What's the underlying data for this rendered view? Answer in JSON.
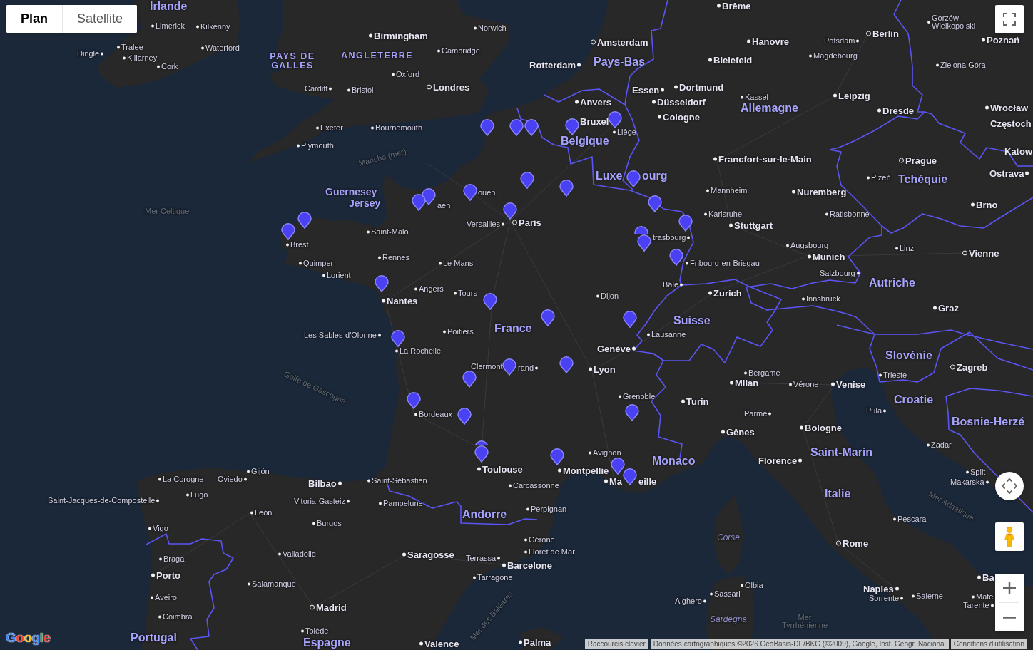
{
  "map_type_control": {
    "tabs": [
      {
        "label": "Plan",
        "selected": true
      },
      {
        "label": "Satellite",
        "selected": false
      }
    ]
  },
  "map": {
    "places": [
      {
        "name": "Irlande",
        "kind": "country"
      },
      {
        "name": "Limerick",
        "kind": "town"
      },
      {
        "name": "Kilkenny",
        "kind": "town"
      },
      {
        "name": "Dingle",
        "kind": "town"
      },
      {
        "name": "Tralee",
        "kind": "town"
      },
      {
        "name": "Waterford",
        "kind": "town"
      },
      {
        "name": "Killarney",
        "kind": "town"
      },
      {
        "name": "Cork",
        "kind": "town"
      },
      {
        "name": "Birmingham",
        "kind": "city"
      },
      {
        "name": "Norwich",
        "kind": "town"
      },
      {
        "name": "PAYS DE GALLES",
        "kind": "region"
      },
      {
        "name": "ANGLETERRE",
        "kind": "region"
      },
      {
        "name": "Cambridge",
        "kind": "town"
      },
      {
        "name": "Oxford",
        "kind": "town"
      },
      {
        "name": "Cardiff",
        "kind": "town"
      },
      {
        "name": "Bristol",
        "kind": "town"
      },
      {
        "name": "Londres",
        "kind": "capital"
      },
      {
        "name": "Exeter",
        "kind": "town"
      },
      {
        "name": "Bournemouth",
        "kind": "town"
      },
      {
        "name": "Plymouth",
        "kind": "town"
      },
      {
        "name": "Manche (mer)",
        "kind": "water"
      },
      {
        "name": "Mer Celtique",
        "kind": "water"
      },
      {
        "name": "Guernesey",
        "kind": "island"
      },
      {
        "name": "Jersey",
        "kind": "island"
      },
      {
        "name": "Brême",
        "kind": "city"
      },
      {
        "name": "Amsterdam",
        "kind": "capital"
      },
      {
        "name": "Hanovre",
        "kind": "city"
      },
      {
        "name": "Potsdam",
        "kind": "town"
      },
      {
        "name": "Berlin",
        "kind": "capital"
      },
      {
        "name": "Gorzów Wielkopolski",
        "kind": "town"
      },
      {
        "name": "Poznań",
        "kind": "city"
      },
      {
        "name": "Rotterdam",
        "kind": "city"
      },
      {
        "name": "Pays-Bas",
        "kind": "country"
      },
      {
        "name": "Bielefeld",
        "kind": "city"
      },
      {
        "name": "Magdebourg",
        "kind": "town"
      },
      {
        "name": "Zielona Góra",
        "kind": "town"
      },
      {
        "name": "Essen",
        "kind": "city"
      },
      {
        "name": "Dortmund",
        "kind": "city"
      },
      {
        "name": "Anvers",
        "kind": "city"
      },
      {
        "name": "Düsseldorf",
        "kind": "city"
      },
      {
        "name": "Kassel",
        "kind": "town"
      },
      {
        "name": "Leipzig",
        "kind": "city"
      },
      {
        "name": "Allemagne",
        "kind": "country"
      },
      {
        "name": "Dresde",
        "kind": "city"
      },
      {
        "name": "Wrocław",
        "kind": "city"
      },
      {
        "name": "Bruxel",
        "kind": "city"
      },
      {
        "name": "Cologne",
        "kind": "city"
      },
      {
        "name": "Częstoch",
        "kind": "city"
      },
      {
        "name": "Belgique",
        "kind": "country"
      },
      {
        "name": "Liège",
        "kind": "town"
      },
      {
        "name": "Francfort-sur-le-Main",
        "kind": "city"
      },
      {
        "name": "Prague",
        "kind": "capital"
      },
      {
        "name": "Katow",
        "kind": "city"
      },
      {
        "name": "Luxe",
        "kind": "country"
      },
      {
        "name": "ourg",
        "kind": "country"
      },
      {
        "name": "Plzeň",
        "kind": "town"
      },
      {
        "name": "Tchéquie",
        "kind": "country"
      },
      {
        "name": "Ostrava",
        "kind": "city"
      },
      {
        "name": "ouen",
        "kind": "town"
      },
      {
        "name": "Mannheim",
        "kind": "town"
      },
      {
        "name": "Nuremberg",
        "kind": "city"
      },
      {
        "name": "aen",
        "kind": "town"
      },
      {
        "name": "Brno",
        "kind": "city"
      },
      {
        "name": "Karlsruhe",
        "kind": "town"
      },
      {
        "name": "Ratisbonne",
        "kind": "town"
      },
      {
        "name": "Saint-Malo",
        "kind": "town"
      },
      {
        "name": "Versailles",
        "kind": "town"
      },
      {
        "name": "Paris",
        "kind": "capital"
      },
      {
        "name": "Stuttgart",
        "kind": "city"
      },
      {
        "name": "trasbourg",
        "kind": "town"
      },
      {
        "name": "Brest",
        "kind": "town"
      },
      {
        "name": "Augsbourg",
        "kind": "town"
      },
      {
        "name": "Linz",
        "kind": "town"
      },
      {
        "name": "Rennes",
        "kind": "town"
      },
      {
        "name": "Munich",
        "kind": "city"
      },
      {
        "name": "Vienne",
        "kind": "capital"
      },
      {
        "name": "Quimper",
        "kind": "town"
      },
      {
        "name": "Le Mans",
        "kind": "town"
      },
      {
        "name": "Fribourg-en-Brisgau",
        "kind": "town"
      },
      {
        "name": "Lorient",
        "kind": "town"
      },
      {
        "name": "Salzbourg",
        "kind": "town"
      },
      {
        "name": "Angers",
        "kind": "town"
      },
      {
        "name": "Nantes",
        "kind": "city"
      },
      {
        "name": "Tours",
        "kind": "town"
      },
      {
        "name": "Dijon",
        "kind": "town"
      },
      {
        "name": "Bâle",
        "kind": "town"
      },
      {
        "name": "Zurich",
        "kind": "city"
      },
      {
        "name": "Innsbruck",
        "kind": "town"
      },
      {
        "name": "Autriche",
        "kind": "country"
      },
      {
        "name": "Graz",
        "kind": "city"
      },
      {
        "name": "Les Sables-d'Olonne",
        "kind": "town"
      },
      {
        "name": "Poitiers",
        "kind": "town"
      },
      {
        "name": "France",
        "kind": "country"
      },
      {
        "name": "Suisse",
        "kind": "country"
      },
      {
        "name": "Lausanne",
        "kind": "town"
      },
      {
        "name": "La Rochelle",
        "kind": "town"
      },
      {
        "name": "Genève",
        "kind": "city"
      },
      {
        "name": "Slovénie",
        "kind": "country"
      },
      {
        "name": "Clermont",
        "kind": "town"
      },
      {
        "name": "rand",
        "kind": "town"
      },
      {
        "name": "Lyon",
        "kind": "city"
      },
      {
        "name": "Bergame",
        "kind": "town"
      },
      {
        "name": "Trieste",
        "kind": "town"
      },
      {
        "name": "Zagreb",
        "kind": "capital"
      },
      {
        "name": "Golfe de Gascogne",
        "kind": "water"
      },
      {
        "name": "Milan",
        "kind": "city"
      },
      {
        "name": "Vérone",
        "kind": "town"
      },
      {
        "name": "Venise",
        "kind": "city"
      },
      {
        "name": "Grenoble",
        "kind": "town"
      },
      {
        "name": "Turin",
        "kind": "city"
      },
      {
        "name": "Croatie",
        "kind": "country"
      },
      {
        "name": "Bordeaux",
        "kind": "town"
      },
      {
        "name": "Parme",
        "kind": "town"
      },
      {
        "name": "Pula",
        "kind": "town"
      },
      {
        "name": "Gênes",
        "kind": "city"
      },
      {
        "name": "Bologne",
        "kind": "city"
      },
      {
        "name": "Bosnie-Herzé",
        "kind": "country"
      },
      {
        "name": "Avignon",
        "kind": "town"
      },
      {
        "name": "Saint-Marin",
        "kind": "country"
      },
      {
        "name": "Zadar",
        "kind": "town"
      },
      {
        "name": "Gijón",
        "kind": "town"
      },
      {
        "name": "Toulouse",
        "kind": "city"
      },
      {
        "name": "Montpellie",
        "kind": "city"
      },
      {
        "name": "Monaco",
        "kind": "country"
      },
      {
        "name": "Florence",
        "kind": "city"
      },
      {
        "name": "Split",
        "kind": "town"
      },
      {
        "name": "La Corogne",
        "kind": "town"
      },
      {
        "name": "Oviedo",
        "kind": "town"
      },
      {
        "name": "Bilbao",
        "kind": "city"
      },
      {
        "name": "Saint-Sébastien",
        "kind": "town"
      },
      {
        "name": "Carcassonne",
        "kind": "town"
      },
      {
        "name": "Ma",
        "kind": "city"
      },
      {
        "name": "eille",
        "kind": "city"
      },
      {
        "name": "Makarska",
        "kind": "town"
      },
      {
        "name": "Saint-Jacques-de-Compostelle",
        "kind": "town"
      },
      {
        "name": "Lugo",
        "kind": "town"
      },
      {
        "name": "Vitoria-Gasteiz",
        "kind": "town"
      },
      {
        "name": "Pampelune",
        "kind": "town"
      },
      {
        "name": "Italie",
        "kind": "country"
      },
      {
        "name": "León",
        "kind": "town"
      },
      {
        "name": "Andorre",
        "kind": "country"
      },
      {
        "name": "Perpignan",
        "kind": "town"
      },
      {
        "name": "Pescara",
        "kind": "town"
      },
      {
        "name": "Mer Adriatique",
        "kind": "water"
      },
      {
        "name": "Vigo",
        "kind": "town"
      },
      {
        "name": "Burgos",
        "kind": "town"
      },
      {
        "name": "Gérone",
        "kind": "town"
      },
      {
        "name": "Corse",
        "kind": "area"
      },
      {
        "name": "Rome",
        "kind": "capital"
      },
      {
        "name": "Braga",
        "kind": "town"
      },
      {
        "name": "Valladolid",
        "kind": "town"
      },
      {
        "name": "Saragosse",
        "kind": "city"
      },
      {
        "name": "Terrassa",
        "kind": "town"
      },
      {
        "name": "Lloret de Mar",
        "kind": "town"
      },
      {
        "name": "Barcelone",
        "kind": "city"
      },
      {
        "name": "Porto",
        "kind": "city"
      },
      {
        "name": "Salamanque",
        "kind": "town"
      },
      {
        "name": "Tarragone",
        "kind": "town"
      },
      {
        "name": "Olbia",
        "kind": "town"
      },
      {
        "name": "Naples",
        "kind": "city"
      },
      {
        "name": "Ba",
        "kind": "city"
      },
      {
        "name": "Aveiro",
        "kind": "town"
      },
      {
        "name": "Madrid",
        "kind": "capital"
      },
      {
        "name": "Mer des Baléares",
        "kind": "water"
      },
      {
        "name": "Alghero",
        "kind": "town"
      },
      {
        "name": "Sassari",
        "kind": "town"
      },
      {
        "name": "Sorrente",
        "kind": "town"
      },
      {
        "name": "Salerne",
        "kind": "town"
      },
      {
        "name": "Mate",
        "kind": "town"
      },
      {
        "name": "Tarente",
        "kind": "town"
      },
      {
        "name": "Coimbra",
        "kind": "town"
      },
      {
        "name": "Sardegna",
        "kind": "area"
      },
      {
        "name": "Mer Tyrrhénienne",
        "kind": "water"
      },
      {
        "name": "Portugal",
        "kind": "country"
      },
      {
        "name": "Tolède",
        "kind": "town"
      },
      {
        "name": "Espagne",
        "kind": "country"
      },
      {
        "name": "Valence",
        "kind": "city"
      },
      {
        "name": "Palma",
        "kind": "city"
      }
    ]
  },
  "logo": {
    "text": "Google"
  },
  "attribution": {
    "shortcuts": "Raccourcis clavier",
    "map_data": "Données cartographiques ©2026 GeoBasis-DE/BKG (©2009), Google, Inst. Geogr. Nacional",
    "terms": "Conditions d'utilisation"
  }
}
